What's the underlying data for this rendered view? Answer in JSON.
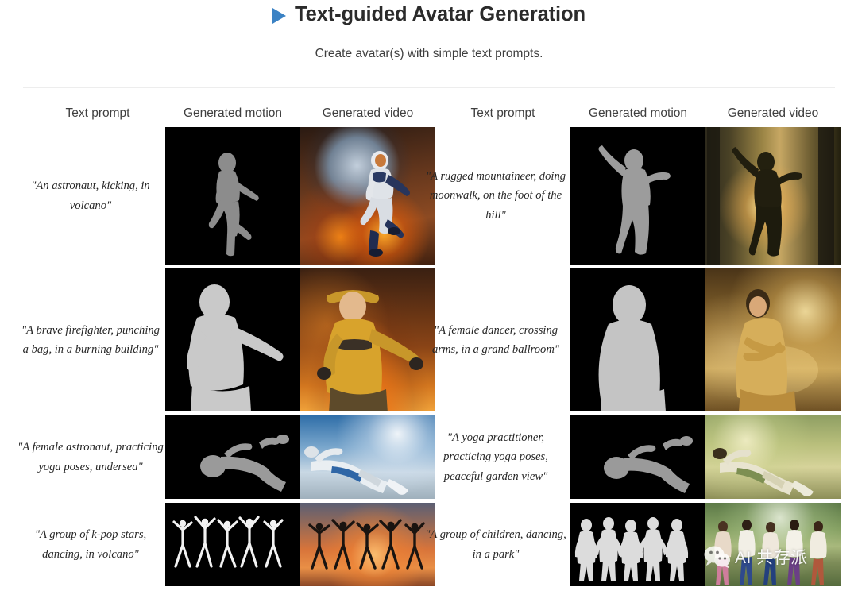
{
  "header": {
    "play_icon": "play-triangle-icon",
    "title": "Text-guided Avatar Generation",
    "subtitle": "Create avatar(s) with simple text prompts.",
    "accent_color": "#3b82c4"
  },
  "columns": {
    "prompt": "Text prompt",
    "motion": "Generated motion",
    "video": "Generated video"
  },
  "groups": [
    {
      "side": "left",
      "rows": [
        {
          "prompt": "\"An astronaut, kicking, in volcano\"",
          "motion": "silhouette-kick",
          "video_scene": "volcano-planet"
        },
        {
          "prompt": "\"A brave firefighter, punching a bag, in a burning building\"",
          "motion": "silhouette-punch",
          "video_scene": "burning-building"
        },
        {
          "prompt": "\"A female astronaut, practicing yoga poses, undersea\"",
          "motion": "silhouette-yoga",
          "video_scene": "undersea-sky"
        },
        {
          "prompt": "\"A group of k-pop stars, dancing, in volcano\"",
          "motion": "silhouette-group-dance",
          "video_scene": "volcano-sunset"
        }
      ]
    },
    {
      "side": "right",
      "rows": [
        {
          "prompt": "\"A rugged mountaineer, doing moonwalk, on the foot of the hill\"",
          "motion": "silhouette-moonwalk",
          "video_scene": "forest-sunrise"
        },
        {
          "prompt": "\"A female dancer, crossing arms, in a grand ballroom\"",
          "motion": "silhouette-crossed-arms",
          "video_scene": "grand-ballroom"
        },
        {
          "prompt": "\"A yoga practitioner, practicing yoga poses, peaceful garden view\"",
          "motion": "silhouette-yoga",
          "video_scene": "peaceful-garden"
        },
        {
          "prompt": "\"A group of children, dancing, in a park\"",
          "motion": "silhouette-group-children",
          "video_scene": "park"
        }
      ]
    }
  ],
  "watermark": {
    "icon": "wechat-icon",
    "text": "AI 共存派"
  }
}
